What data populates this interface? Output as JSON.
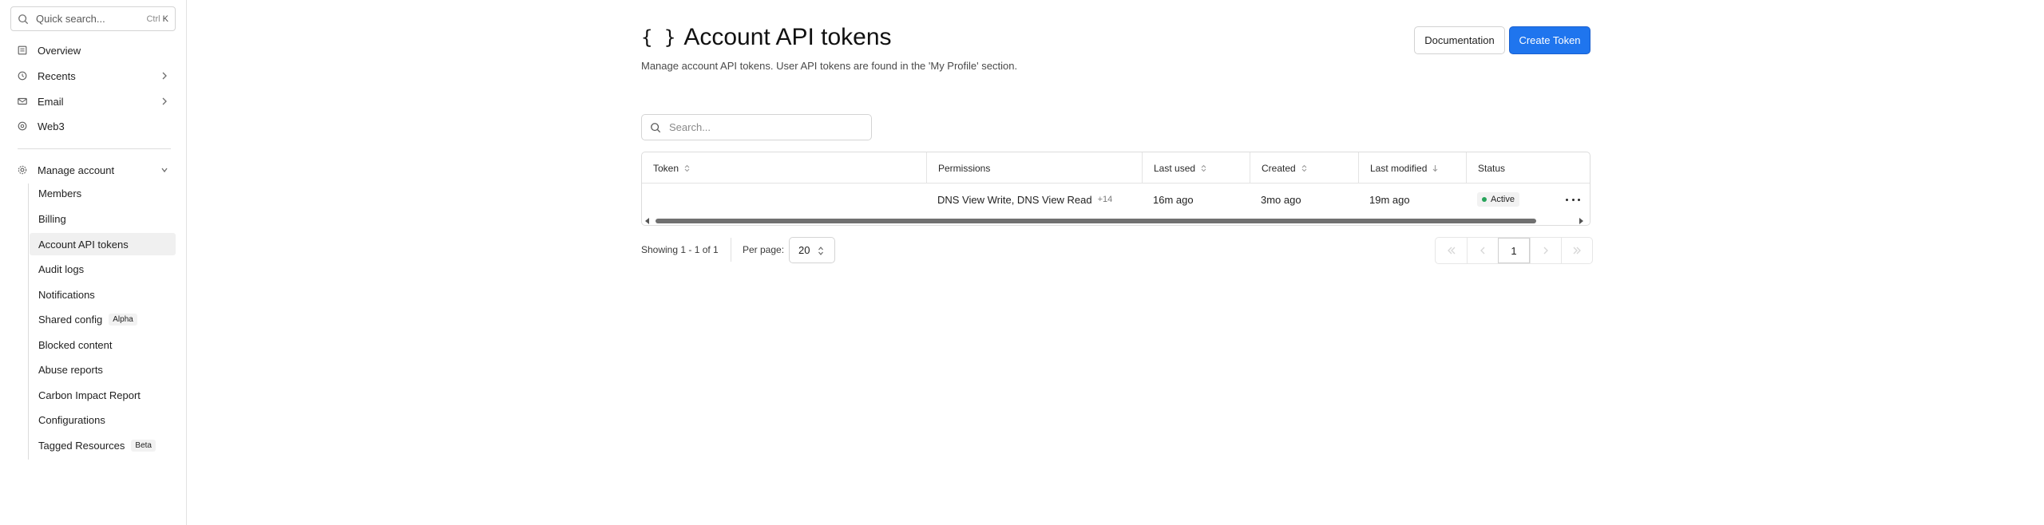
{
  "sidebar": {
    "search": {
      "placeholder": "Quick search...",
      "shortcut_mod": "Ctrl",
      "shortcut_key": "K"
    },
    "items": [
      {
        "label": "Overview",
        "icon": "document-icon"
      },
      {
        "label": "Recents",
        "icon": "clock-icon"
      },
      {
        "label": "Email",
        "icon": "email-icon"
      },
      {
        "label": "Web3",
        "icon": "web3-icon"
      }
    ],
    "manage": {
      "label": "Manage account",
      "icon": "gear-icon"
    },
    "sub_items": [
      {
        "label": "Members"
      },
      {
        "label": "Billing"
      },
      {
        "label": "Account API tokens"
      },
      {
        "label": "Audit logs"
      },
      {
        "label": "Notifications"
      },
      {
        "label": "Shared config",
        "badge": "Alpha"
      },
      {
        "label": "Blocked content"
      },
      {
        "label": "Abuse reports"
      },
      {
        "label": "Carbon Impact Report"
      },
      {
        "label": "Configurations"
      },
      {
        "label": "Tagged Resources",
        "badge": "Beta"
      }
    ],
    "active_item": "Account API tokens"
  },
  "header": {
    "icon": "{ }",
    "title": "Account API tokens",
    "subtitle": "Manage account API tokens. User API tokens are found in the 'My Profile' section.",
    "doc_button": "Documentation",
    "create_button": "Create Token"
  },
  "table_search": {
    "placeholder": "Search..."
  },
  "table": {
    "columns": [
      "Token",
      "Permissions",
      "Last used",
      "Created",
      "Last modified",
      "Status"
    ],
    "rows": [
      {
        "token": "",
        "permissions": "DNS View Write, DNS View Read",
        "permissions_more": "+14",
        "last_used": "16m ago",
        "created": "3mo ago",
        "last_modified": "19m ago",
        "status": "Active"
      }
    ]
  },
  "footer": {
    "showing": "Showing 1 - 1 of 1",
    "per_page_label": "Per page:",
    "per_page_value": "20",
    "current_page": "1"
  },
  "colors": {
    "accent": "#1f75ee",
    "status_active": "#27a35a"
  }
}
